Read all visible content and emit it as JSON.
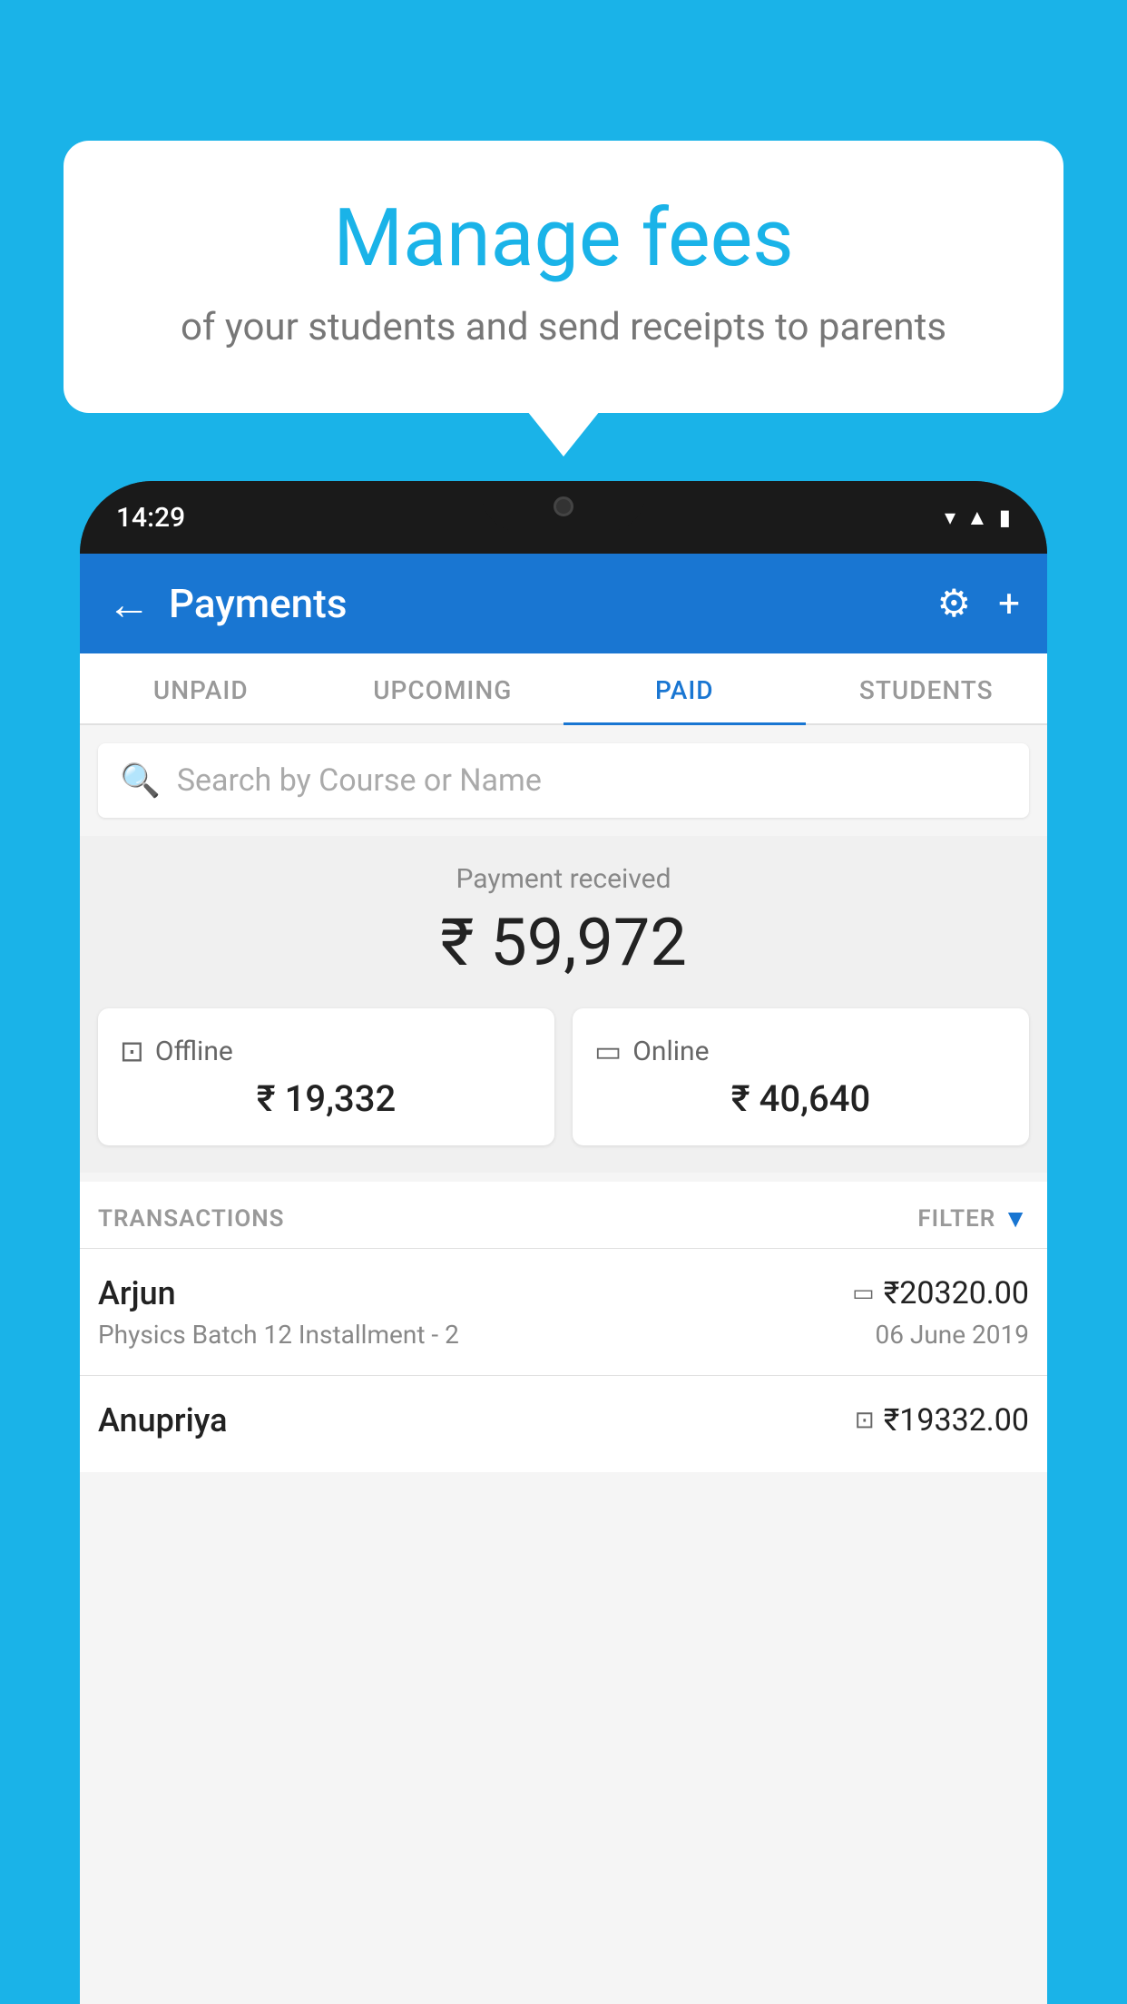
{
  "background": {
    "color": "#1ab3e8"
  },
  "speech_bubble": {
    "title": "Manage fees",
    "subtitle": "of your students and send receipts to parents"
  },
  "phone": {
    "status_bar": {
      "time": "14:29"
    },
    "app_bar": {
      "title": "Payments",
      "back_icon": "←",
      "settings_icon": "⚙",
      "add_icon": "+"
    },
    "tabs": [
      {
        "label": "UNPAID",
        "active": false
      },
      {
        "label": "UPCOMING",
        "active": false
      },
      {
        "label": "PAID",
        "active": true
      },
      {
        "label": "STUDENTS",
        "active": false
      }
    ],
    "search": {
      "placeholder": "Search by Course or Name"
    },
    "payment_summary": {
      "label": "Payment received",
      "amount": "₹ 59,972",
      "offline": {
        "label": "Offline",
        "amount": "₹ 19,332"
      },
      "online": {
        "label": "Online",
        "amount": "₹ 40,640"
      }
    },
    "transactions": {
      "header_label": "TRANSACTIONS",
      "filter_label": "FILTER",
      "items": [
        {
          "name": "Arjun",
          "detail": "Physics Batch 12 Installment - 2",
          "amount": "₹20320.00",
          "date": "06 June 2019",
          "type": "online"
        },
        {
          "name": "Anupriya",
          "detail": "",
          "amount": "₹19332.00",
          "date": "",
          "type": "offline"
        }
      ]
    }
  }
}
